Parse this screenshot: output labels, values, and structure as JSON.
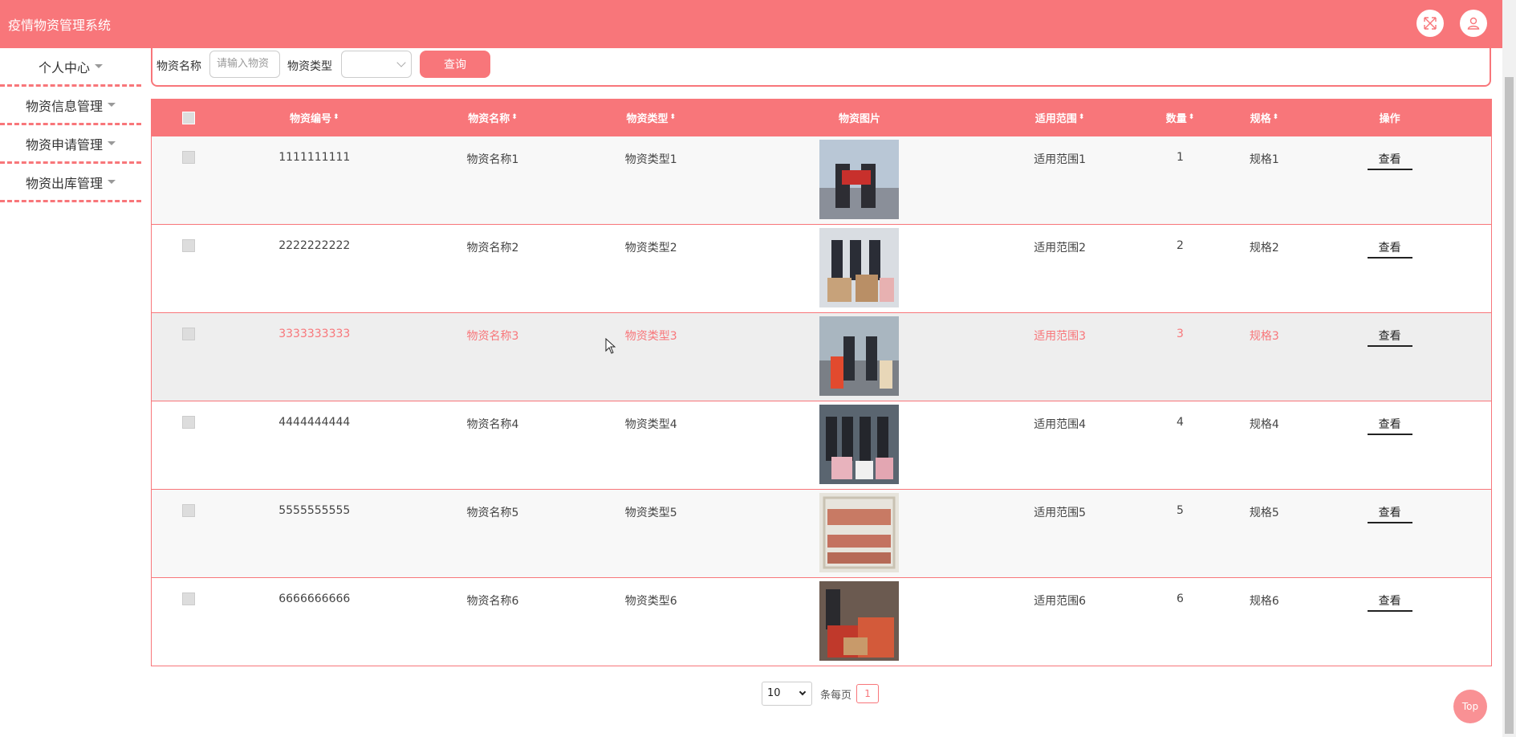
{
  "app": {
    "title": "疫情物资管理系统"
  },
  "header": {
    "fullscreen_icon": "fullscreen-icon",
    "user_icon": "user-icon"
  },
  "sidebar": {
    "items": [
      {
        "label": "个人中心"
      },
      {
        "label": "物资信息管理"
      },
      {
        "label": "物资申请管理"
      },
      {
        "label": "物资出库管理"
      }
    ]
  },
  "search": {
    "name_label": "物资名称",
    "name_placeholder": "请输入物资",
    "type_label": "物资类型",
    "type_value": "",
    "query_button": "查询"
  },
  "table": {
    "columns": [
      "物资编号",
      "物资名称",
      "物资类型",
      "物资图片",
      "适用范围",
      "数量",
      "规格",
      "操作"
    ],
    "rows": [
      {
        "code": "1111111111",
        "name": "物资名称1",
        "type": "物资类型1",
        "scope": "适用范围1",
        "qty": "1",
        "spec": "规格1",
        "action": "查看"
      },
      {
        "code": "2222222222",
        "name": "物资名称2",
        "type": "物资类型2",
        "scope": "适用范围2",
        "qty": "2",
        "spec": "规格2",
        "action": "查看"
      },
      {
        "code": "3333333333",
        "name": "物资名称3",
        "type": "物资类型3",
        "scope": "适用范围3",
        "qty": "3",
        "spec": "规格3",
        "action": "查看"
      },
      {
        "code": "4444444444",
        "name": "物资名称4",
        "type": "物资类型4",
        "scope": "适用范围4",
        "qty": "4",
        "spec": "规格4",
        "action": "查看"
      },
      {
        "code": "5555555555",
        "name": "物资名称5",
        "type": "物资类型5",
        "scope": "适用范围5",
        "qty": "5",
        "spec": "规格5",
        "action": "查看"
      },
      {
        "code": "6666666666",
        "name": "物资名称6",
        "type": "物资类型6",
        "scope": "适用范围6",
        "qty": "6",
        "spec": "规格6",
        "action": "查看"
      }
    ]
  },
  "pagination": {
    "page_size": "10",
    "per_page_label": "条每页",
    "current_page": "1"
  },
  "to_top": {
    "label": "Top"
  },
  "colors": {
    "accent": "#f8767a"
  }
}
